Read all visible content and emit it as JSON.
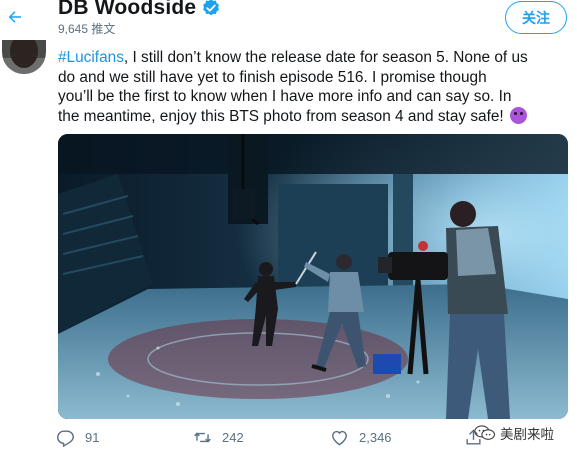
{
  "header": {
    "display_name": "DB Woodside",
    "tweet_count": "9,645 推文",
    "follow_label": "关注"
  },
  "tweet": {
    "hashtag": "#Lucifans",
    "text_line1_rest": ", I still don’t know the release date for season 5. None of us",
    "text_line2": "do and we still have yet to finish episode 516. I promise though",
    "text_line3": "you’ll be the first to know when I have more info and can say so. In",
    "text_line4": "the meantime, enjoy this BTS photo from season 4 and stay safe!"
  },
  "media": {
    "description_icon": "photo"
  },
  "actions": {
    "reply_count": "91",
    "retweet_count": "242",
    "like_count": "2,346"
  },
  "watermark": {
    "text": "美剧来啦"
  },
  "colors": {
    "accent": "#1da1f2",
    "text": "#14171a",
    "secondary": "#5b7083",
    "hashtag": "#1b95e0"
  },
  "icons": [
    "back-arrow-icon",
    "verified-badge-icon",
    "reply-icon",
    "retweet-icon",
    "like-icon",
    "share-icon",
    "devil-emoji-icon",
    "wechat-icon"
  ]
}
